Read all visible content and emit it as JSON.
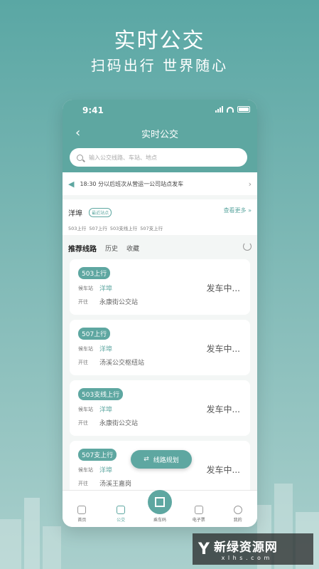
{
  "promo": {
    "title": "实时公交",
    "subtitle": "扫码出行 世界随心"
  },
  "status_bar": {
    "time": "9:41"
  },
  "nav": {
    "title": "实时公交"
  },
  "search": {
    "placeholder": "输入公交线路、车站、地点"
  },
  "notice": {
    "text": "18:30 分以后班次从营运一公司站点发车"
  },
  "nearby_stop": {
    "name": "洋埠",
    "badge": "最近站点",
    "view_more": "查看更多 »",
    "routes": [
      "503上行",
      "507上行",
      "503支线上行",
      "507支上行"
    ]
  },
  "tabs": [
    {
      "label": "推荐线路"
    },
    {
      "label": "历史"
    },
    {
      "label": "收藏"
    }
  ],
  "routes": [
    {
      "line": "503上行",
      "wait_label": "候车站",
      "wait_stop": "洋埠",
      "to_label": "开往",
      "destination": "永康街公交站",
      "status": "发车中..."
    },
    {
      "line": "507上行",
      "wait_label": "候车站",
      "wait_stop": "洋埠",
      "to_label": "开往",
      "destination": "汤溪公交枢纽站",
      "status": "发车中..."
    },
    {
      "line": "503支线上行",
      "wait_label": "候车站",
      "wait_stop": "洋埠",
      "to_label": "开往",
      "destination": "永康街公交站",
      "status": "发车中..."
    },
    {
      "line": "507支上行",
      "wait_label": "候车站",
      "wait_stop": "洋埠",
      "to_label": "开往",
      "destination": "汤溪王嘉岗",
      "status": "发车中..."
    }
  ],
  "plan_button": {
    "label": "线路规划"
  },
  "tabbar": [
    {
      "label": "首页",
      "icon": "home-icon"
    },
    {
      "label": "公交",
      "icon": "bus-icon"
    },
    {
      "label": "乘车码",
      "icon": "qr-code-icon"
    },
    {
      "label": "电子票",
      "icon": "ticket-icon"
    },
    {
      "label": "我的",
      "icon": "user-icon"
    }
  ],
  "watermark": {
    "logo": "Y",
    "name": "新绿资源网",
    "url": "x l h s . c o m"
  },
  "colors": {
    "accent": "#5ea7a1",
    "background": "#7fb9b6"
  }
}
